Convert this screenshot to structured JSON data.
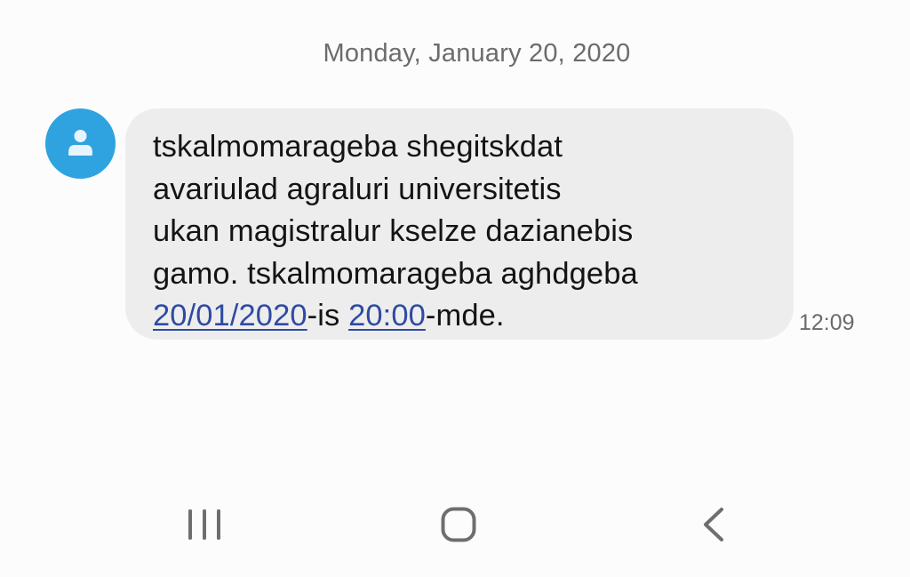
{
  "conversation": {
    "date_header": "Monday, January 20, 2020"
  },
  "contact": {
    "avatar_icon": "person-icon",
    "avatar_color": "#2ea3df"
  },
  "message": {
    "line1": "tskalmomarageba shegitskdat",
    "line2": "avariulad agraluri universitetis",
    "line3": "ukan magistralur kselze dazianebis",
    "line4": "gamo. tskalmomarageba aghdgeba",
    "link_date": "20/01/2020",
    "text_after_date": "-is ",
    "link_time": "20:00",
    "text_after_time": "-mde.",
    "time": "12:09",
    "link_color": "#2f4aa3",
    "bubble_color": "#ededed"
  },
  "navigation": {
    "recents_icon": "recents-icon",
    "home_icon": "home-icon",
    "back_icon": "back-icon"
  }
}
